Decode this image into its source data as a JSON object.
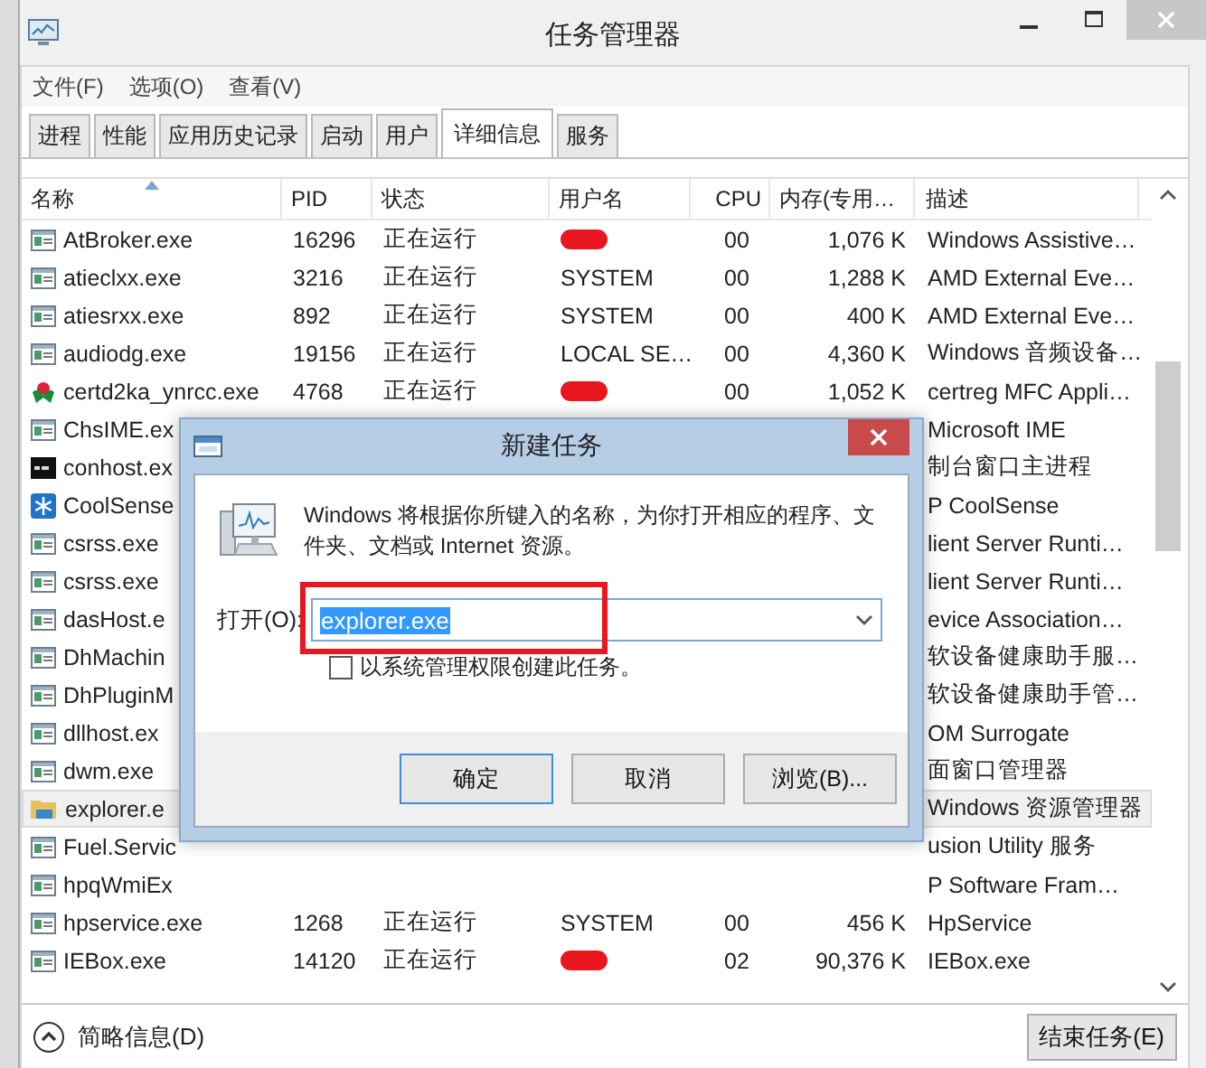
{
  "window": {
    "title": "任务管理器"
  },
  "menu": [
    "文件(F)",
    "选项(O)",
    "查看(V)"
  ],
  "tabs": [
    {
      "label": "进程",
      "selected": false
    },
    {
      "label": "性能",
      "selected": false
    },
    {
      "label": "应用历史记录",
      "selected": false
    },
    {
      "label": "启动",
      "selected": false
    },
    {
      "label": "用户",
      "selected": false
    },
    {
      "label": "详细信息",
      "selected": true
    },
    {
      "label": "服务",
      "selected": false
    }
  ],
  "table": {
    "columns": [
      {
        "label": "名称",
        "sorted": true
      },
      {
        "label": "PID",
        "sorted": false
      },
      {
        "label": "状态",
        "sorted": false
      },
      {
        "label": "用户名",
        "sorted": false
      },
      {
        "label": "CPU",
        "sorted": false
      },
      {
        "label": "内存(专用…",
        "sorted": false
      },
      {
        "label": "描述",
        "sorted": false
      }
    ],
    "rows": [
      {
        "kind": "app",
        "name": "AtBroker.exe",
        "pid": "16296",
        "status": "正在运行",
        "user_redacted": true,
        "cpu": "00",
        "memory": "1,076 K",
        "description": "Windows Assistive…",
        "selected": false
      },
      {
        "kind": "app",
        "name": "atieclxx.exe",
        "pid": "3216",
        "status": "正在运行",
        "user": "SYSTEM",
        "cpu": "00",
        "memory": "1,288 K",
        "description": "AMD External Eve…",
        "selected": false
      },
      {
        "kind": "app",
        "name": "atiesrxx.exe",
        "pid": "892",
        "status": "正在运行",
        "user": "SYSTEM",
        "cpu": "00",
        "memory": "400 K",
        "description": "AMD External Eve…",
        "selected": false
      },
      {
        "kind": "app",
        "name": "audiodg.exe",
        "pid": "19156",
        "status": "正在运行",
        "user": "LOCAL SE…",
        "cpu": "00",
        "memory": "4,360 K",
        "description": "Windows 音频设备…",
        "selected": false
      },
      {
        "kind": "cert",
        "name": "certd2ka_ynrcc.exe",
        "pid": "4768",
        "status": "正在运行",
        "user_redacted": true,
        "cpu": "00",
        "memory": "1,052 K",
        "description": "certreg MFC Appli…",
        "selected": false
      },
      {
        "kind": "app",
        "name": "ChsIME.ex",
        "description": "Microsoft IME",
        "selected": false
      },
      {
        "kind": "console",
        "name": "conhost.ex",
        "description": "制台窗口主进程",
        "selected": false
      },
      {
        "kind": "snowflake",
        "name": "CoolSense",
        "description": "P CoolSense",
        "selected": false
      },
      {
        "kind": "app",
        "name": "csrss.exe",
        "description": "lient Server Runti…",
        "selected": false
      },
      {
        "kind": "app",
        "name": "csrss.exe",
        "description": "lient Server Runti…",
        "selected": false
      },
      {
        "kind": "app",
        "name": "dasHost.e",
        "description": "evice Association…",
        "selected": false
      },
      {
        "kind": "app",
        "name": "DhMachin",
        "description": "软设备健康助手服…",
        "selected": false
      },
      {
        "kind": "app",
        "name": "DhPluginM",
        "description": "软设备健康助手管…",
        "selected": false
      },
      {
        "kind": "app",
        "name": "dllhost.ex",
        "description": "OM Surrogate",
        "selected": false
      },
      {
        "kind": "app",
        "name": "dwm.exe",
        "description": "面窗口管理器",
        "selected": false
      },
      {
        "kind": "folder",
        "name": "explorer.e",
        "description": "Windows 资源管理器",
        "selected": true
      },
      {
        "kind": "app",
        "name": "Fuel.Servic",
        "description": "usion Utility 服务",
        "selected": false
      },
      {
        "kind": "app",
        "name": "hpqWmiEx",
        "description": "P Software Fram…",
        "selected": false
      },
      {
        "kind": "app",
        "name": "hpservice.exe",
        "pid": "1268",
        "status": "正在运行",
        "user": "SYSTEM",
        "cpu": "00",
        "memory": "456 K",
        "description": "HpService",
        "selected": false
      },
      {
        "kind": "app",
        "name": "IEBox.exe",
        "pid": "14120",
        "status": "正在运行",
        "user_redacted": true,
        "cpu": "02",
        "memory": "90,376 K",
        "description": "IEBox.exe",
        "selected": false
      }
    ]
  },
  "footer": {
    "details_toggle": "简略信息(D)",
    "end_task_button": "结束任务(E)"
  },
  "dialog": {
    "title": "新建任务",
    "message": "Windows 将根据你所键入的名称，为你打开相应的程序、文件夹、文档或 Internet 资源。",
    "open_label": "打开(O):",
    "open_value": "explorer.exe",
    "value_selected": true,
    "highlighted": true,
    "admin_checkbox": {
      "label": "以系统管理权限创建此任务。",
      "checked": false
    },
    "buttons": [
      {
        "label": "确定",
        "default": true
      },
      {
        "label": "取消",
        "default": false
      },
      {
        "label": "浏览(B)...",
        "default": false
      }
    ]
  }
}
